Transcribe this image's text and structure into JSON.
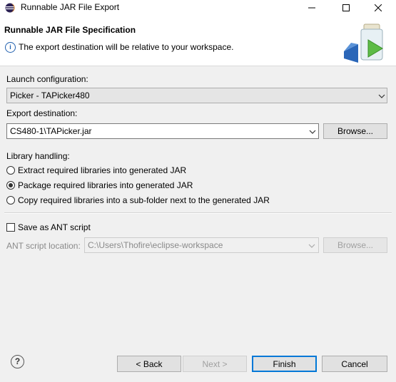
{
  "window": {
    "title": "Runnable JAR File Export"
  },
  "header": {
    "title": "Runnable JAR File Specification",
    "message": "The export destination will be relative to your workspace."
  },
  "launch": {
    "label": "Launch configuration:",
    "value": "Picker - TAPicker480"
  },
  "export": {
    "label": "Export destination:",
    "value": "CS480-1\\TAPicker.jar",
    "browse": "Browse..."
  },
  "library": {
    "label": "Library handling:",
    "options": [
      "Extract required libraries into generated JAR",
      "Package required libraries into generated JAR",
      "Copy required libraries into a sub-folder next to the generated JAR"
    ],
    "selected": 1
  },
  "ant": {
    "checkbox_label": "Save as ANT script",
    "checked": false,
    "location_label": "ANT script location:",
    "location_value": "C:\\Users\\Thofire\\eclipse-workspace",
    "browse": "Browse..."
  },
  "buttons": {
    "back": "< Back",
    "next": "Next >",
    "finish": "Finish",
    "cancel": "Cancel"
  },
  "colors": {
    "accent": "#0078d7",
    "info": "#1f5fae"
  }
}
